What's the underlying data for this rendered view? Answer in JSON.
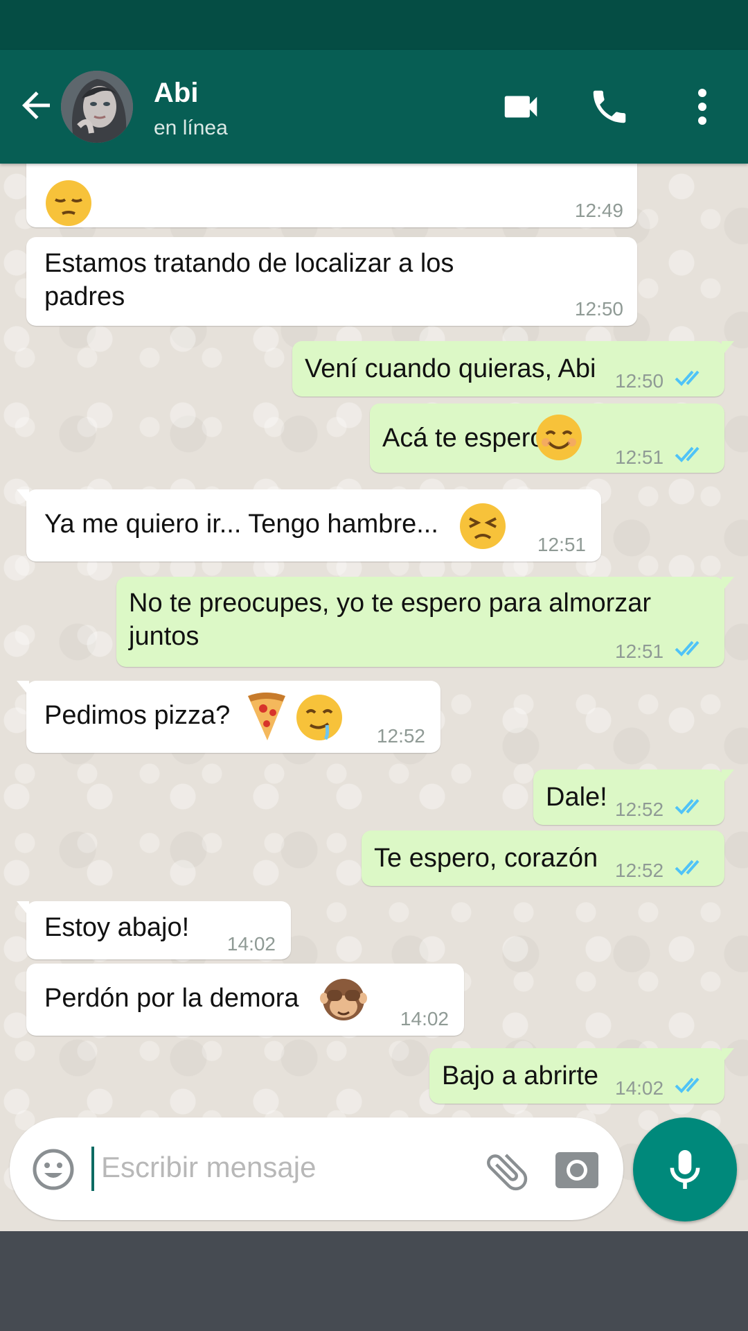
{
  "header": {
    "contact_name": "Abi",
    "status": "en línea"
  },
  "messages": [
    {
      "direction": "in",
      "text": "",
      "emoji": "pensive",
      "time": "12:49"
    },
    {
      "direction": "in",
      "lines": [
        "Estamos tratando de localizar a los",
        "padres"
      ],
      "time": "12:50"
    },
    {
      "direction": "out",
      "text": "Vení cuando quieras, Abi",
      "time": "12:50",
      "ticks": "read"
    },
    {
      "direction": "out",
      "text": "Acá te espero",
      "emoji": "smiling-face",
      "time": "12:51",
      "ticks": "read"
    },
    {
      "direction": "in",
      "text": "Ya me quiero ir... Tengo hambre...",
      "emoji": "persevering-face",
      "time": "12:51"
    },
    {
      "direction": "out",
      "lines": [
        "No te preocupes, yo te espero para almorzar",
        "juntos"
      ],
      "time": "12:51",
      "ticks": "read"
    },
    {
      "direction": "in",
      "text": "Pedimos pizza?",
      "emoji": "pizza drooling-face",
      "time": "12:52"
    },
    {
      "direction": "out",
      "text": "Dale!",
      "time": "12:52",
      "ticks": "read"
    },
    {
      "direction": "out",
      "text": "Te espero, corazón",
      "time": "12:52",
      "ticks": "read"
    },
    {
      "direction": "in",
      "text": "Estoy abajo!",
      "time": "14:02"
    },
    {
      "direction": "in",
      "text": "Perdón por la demora",
      "emoji": "see-no-evil-monkey",
      "time": "14:02"
    },
    {
      "direction": "out",
      "text": "Bajo a abrirte",
      "time": "14:02",
      "ticks": "read"
    }
  ],
  "composer": {
    "placeholder": "Escribir mensaje"
  },
  "colors": {
    "header": "#075E54",
    "statusbar": "#054D44",
    "outgoing_bubble": "#DCF8C6",
    "incoming_bubble": "#FFFFFF",
    "read_ticks": "#4FC3F7",
    "mic_button": "#00897B"
  },
  "icons": {
    "back": "arrow-left-icon",
    "video": "video-camera-icon",
    "call": "phone-icon",
    "menu": "more-vert-icon",
    "emoji": "emoji-icon",
    "attach": "paperclip-icon",
    "camera": "camera-icon",
    "mic": "microphone-icon"
  }
}
